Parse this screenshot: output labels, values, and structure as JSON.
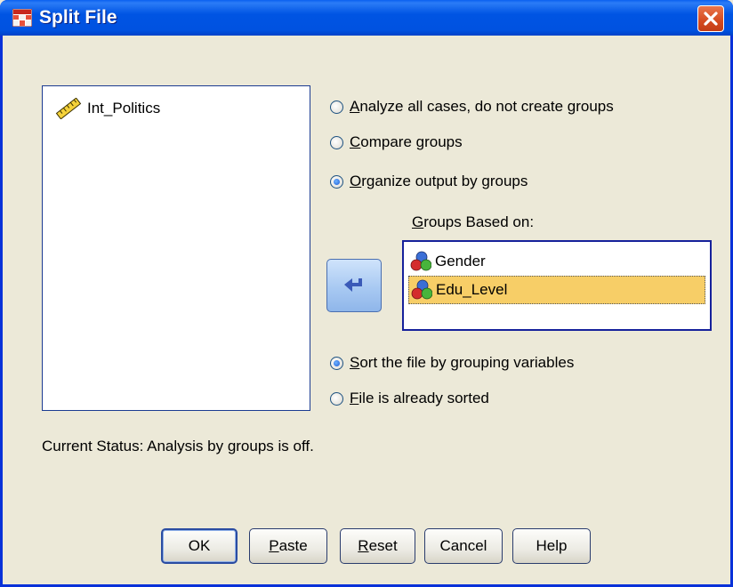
{
  "window": {
    "title": "Split File",
    "icon": "split-file-grid-icon",
    "close_icon": "close-icon"
  },
  "variable_list": {
    "items": [
      {
        "label": "Int_Politics",
        "icon": "scale-measure-ruler-icon"
      }
    ]
  },
  "options": {
    "analyze_all": {
      "label": "Analyze all cases, do not create groups",
      "mnemonic": "A",
      "rest": "nalyze all cases, do not create groups",
      "selected": false
    },
    "compare_groups": {
      "label": "Compare groups",
      "mnemonic": "C",
      "rest": "ompare groups",
      "selected": false
    },
    "organize_output": {
      "label": "Organize output by groups",
      "mnemonic": "O",
      "rest": "rganize output by groups",
      "selected": true
    }
  },
  "groups": {
    "label": "Groups Based on:",
    "label_mnemonic": "G",
    "label_rest": "roups Based on:",
    "items": [
      {
        "label": "Gender",
        "icon": "nominal-measure-icon",
        "selected": false
      },
      {
        "label": "Edu_Level",
        "icon": "nominal-measure-icon",
        "selected": true
      }
    ]
  },
  "move_button": {
    "icon": "left-arrow-icon"
  },
  "sorting": {
    "sort_file": {
      "label": "Sort the file by grouping variables",
      "mnemonic": "S",
      "rest": "ort the file by grouping variables",
      "selected": true
    },
    "already_sorted": {
      "label": "File is already sorted",
      "mnemonic": "F",
      "rest": "ile is already sorted",
      "selected": false
    }
  },
  "status": "Current Status: Analysis by groups is off.",
  "buttons": {
    "ok": "OK",
    "paste": {
      "label": "Paste",
      "mnemonic": "P",
      "rest": "aste"
    },
    "reset": {
      "label": "Reset",
      "mnemonic": "R",
      "rest": "eset"
    },
    "cancel": "Cancel",
    "help": "Help"
  },
  "colors": {
    "title_bar": "#0054e3",
    "dialog_bg": "#ece9d8",
    "selection": "#f7ce67",
    "list_border": "#16219b"
  }
}
